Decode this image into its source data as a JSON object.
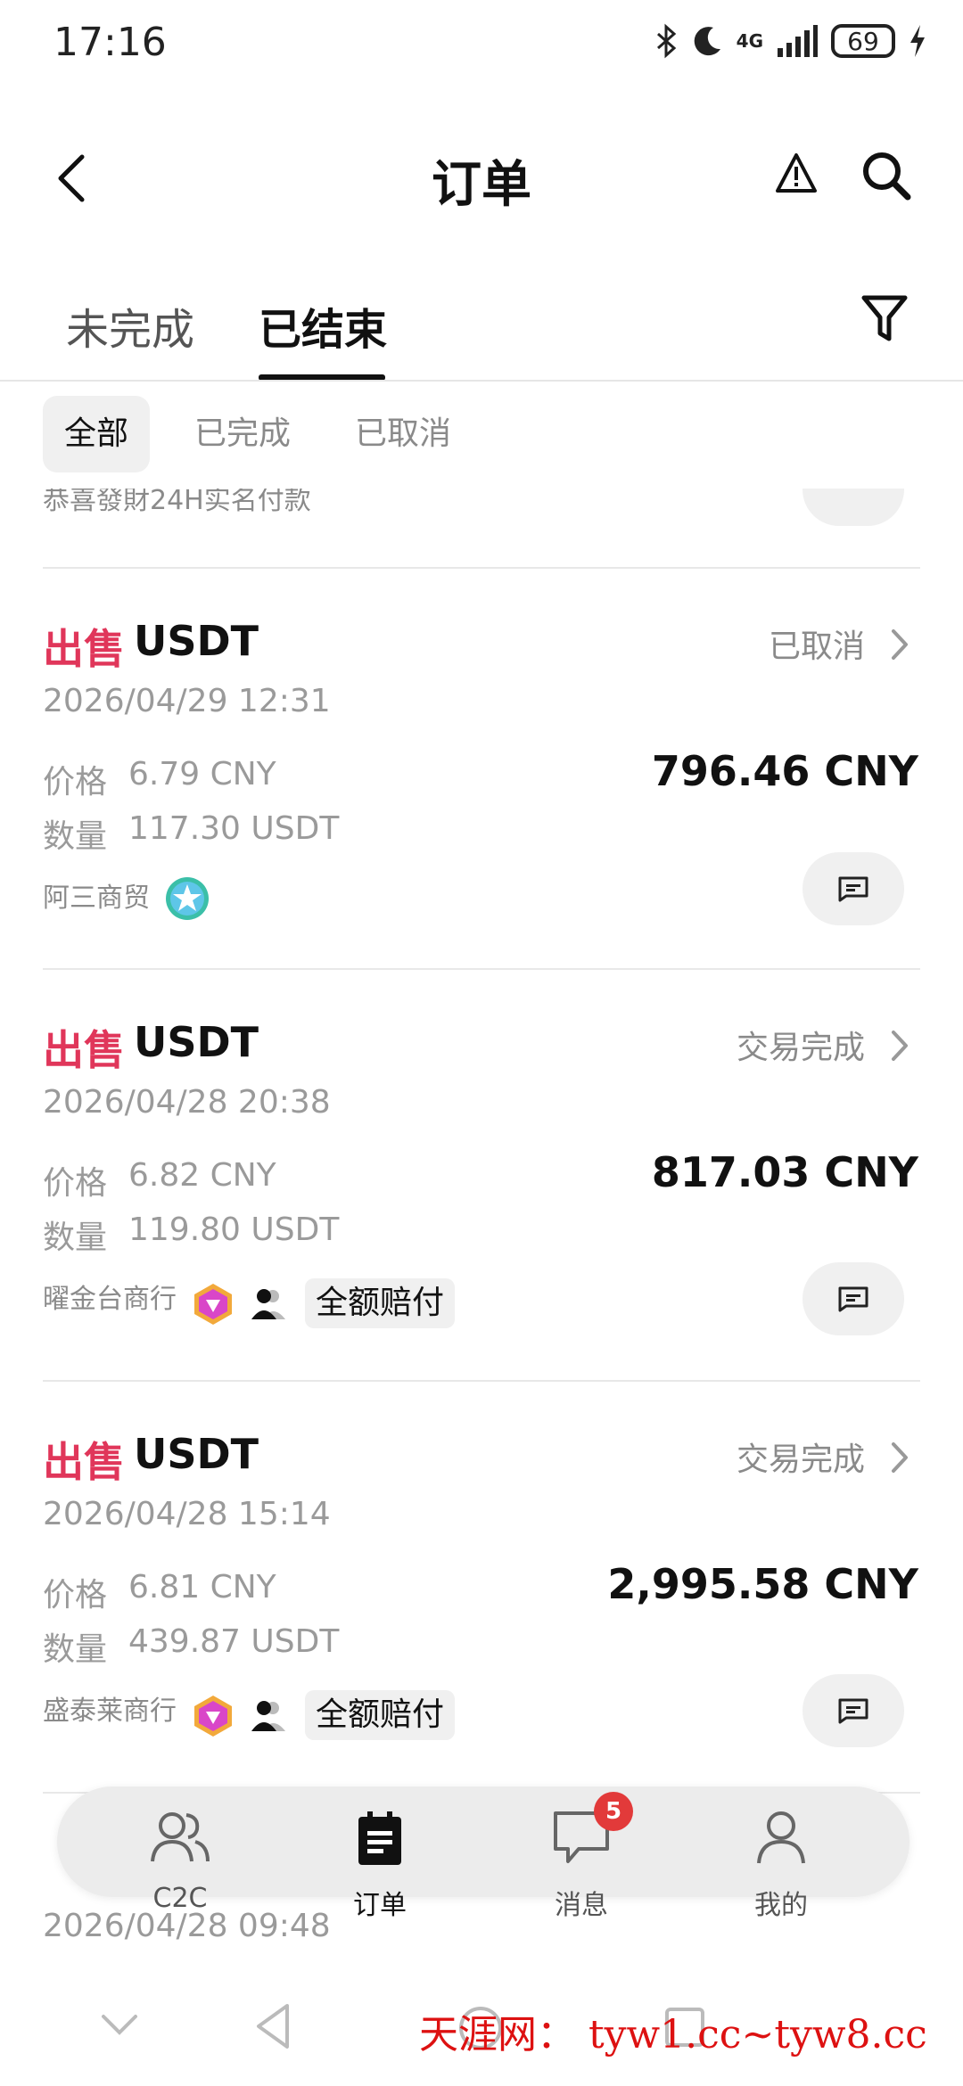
{
  "status_bar": {
    "time": "17:16",
    "battery": "69",
    "network": "4G"
  },
  "header": {
    "title": "订单"
  },
  "tabs": [
    {
      "label": "未完成",
      "active": false
    },
    {
      "label": "已结束",
      "active": true
    }
  ],
  "chips": [
    {
      "label": "全部",
      "active": true
    },
    {
      "label": "已完成",
      "active": false
    },
    {
      "label": "已取消",
      "active": false
    }
  ],
  "peek": {
    "merchant": "恭喜發財24H实名付款",
    "tag": "全额赔付"
  },
  "labels": {
    "price": "价格",
    "qty": "数量",
    "compensate": "全额赔付"
  },
  "orders": [
    {
      "side": "出售",
      "asset": "USDT",
      "status": "已取消",
      "date": "2026/04/29 12:31",
      "price": "6.79 CNY",
      "qty": "117.30 USDT",
      "total": "796.46 CNY",
      "merchant": "阿三商贸",
      "badge": "star"
    },
    {
      "side": "出售",
      "asset": "USDT",
      "status": "交易完成",
      "date": "2026/04/28 20:38",
      "price": "6.82 CNY",
      "qty": "119.80 USDT",
      "total": "817.03 CNY",
      "merchant": "曜金台商行",
      "badge": "diamond"
    },
    {
      "side": "出售",
      "asset": "USDT",
      "status": "交易完成",
      "date": "2026/04/28 15:14",
      "price": "6.81 CNY",
      "qty": "439.87 USDT",
      "total": "2,995.58 CNY",
      "merchant": "盛泰莱商行",
      "badge": "diamond"
    }
  ],
  "peek_bottom": {
    "date": "2026/04/28 09:48"
  },
  "bottom_nav": [
    {
      "label": "C2C",
      "icon": "users-icon",
      "active": false
    },
    {
      "label": "订单",
      "icon": "clipboard-icon",
      "active": true
    },
    {
      "label": "消息",
      "icon": "message-icon",
      "active": false,
      "badge": "5"
    },
    {
      "label": "我的",
      "icon": "user-icon",
      "active": false
    }
  ],
  "watermark": "天涯网： tyw1.cc~tyw8.cc",
  "colors": {
    "sell": "#e0365a",
    "badge": "#e23a3a",
    "text": "#111111",
    "muted": "#8a8a8a"
  }
}
